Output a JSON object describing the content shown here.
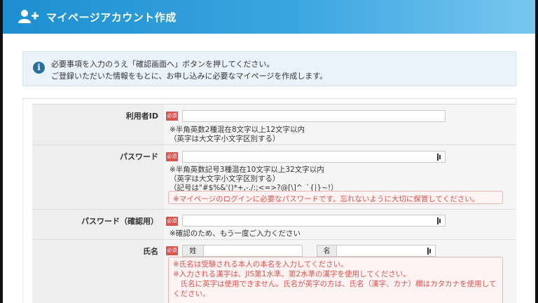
{
  "header": {
    "title": "マイページアカウント作成"
  },
  "notice": {
    "line1": "必要事項を入力のうえ「確認画面へ」ボタンを押してください。",
    "line2": "ご登録いただいた情報をもとに、お申し込みに必要なマイページを作成します。"
  },
  "required_label": "必須",
  "fields": {
    "userid": {
      "label": "利用者ID",
      "value": "",
      "note1": "※半角英数2種混在8文字以上12文字以内",
      "note2": "（英字は大文字小文字区別する）"
    },
    "password": {
      "label": "パスワード",
      "value": "",
      "note1": "※半角英数記号3種混在10文字以上32文字以内",
      "note2": "（英字は大文字小文字区別する）",
      "note3": "（記号は\"#$%&'()*+,-./:;<=>?@[\\]^_`{|}~!）",
      "warning": "※マイページのログインに必要なパスワードです。忘れないように大切に保管してください。"
    },
    "password_confirm": {
      "label": "パスワード（確認用）",
      "value": "",
      "note1": "※確認のため、もう一度ご入力ください"
    },
    "name": {
      "label": "氏名",
      "sei_label": "姓",
      "mei_label": "名",
      "sei_value": "",
      "mei_value": "",
      "warn1": "※氏名は受験される本人の本名を入力してください。",
      "warn2": "※入力される漢字は、JIS第1水準、第2水準の漢字を使用してください。",
      "warn3": "　氏名に英字は使用できません。氏名が英字の方は、氏名（漢字、カナ）欄はカタカナを使用して",
      "warn4": "ください。"
    }
  },
  "icons": {
    "header": "add-user-icon",
    "notice": "info-icon",
    "password_toggle": "password-reveal-icon"
  },
  "colors": {
    "header_start": "#1d8fd0",
    "header_end": "#78c6ef",
    "required": "#d9534f",
    "warning_text": "#d9534f",
    "notice_bg": "#e9f3f9"
  }
}
